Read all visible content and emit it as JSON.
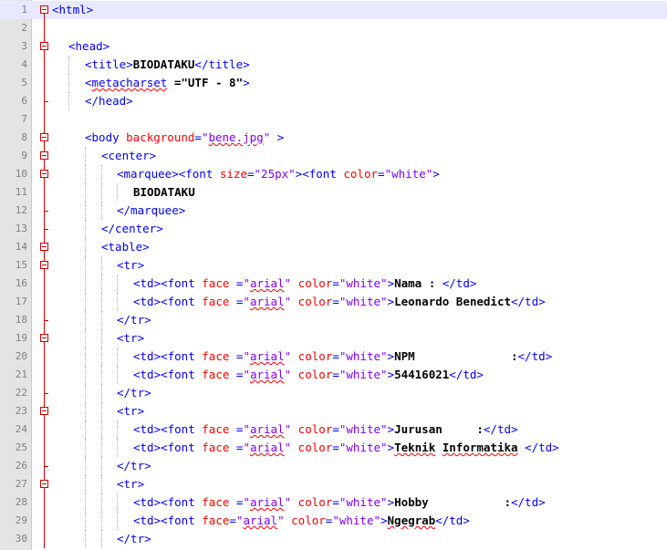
{
  "editor": {
    "lines": [
      {
        "n": "1",
        "tokens": [
          [
            "t",
            "<html>"
          ]
        ]
      },
      {
        "n": "2",
        "tokens": []
      },
      {
        "n": "3",
        "tokens": [
          [
            "t",
            "<head>"
          ]
        ]
      },
      {
        "n": "4",
        "tokens": [
          [
            "t",
            "<title>"
          ],
          [
            "tx",
            "BIODATAKU"
          ],
          [
            "t",
            "</title>"
          ]
        ]
      },
      {
        "n": "5",
        "tokens": [
          [
            "t",
            "<"
          ],
          [
            "sq",
            "metacharset"
          ],
          [
            "tx",
            " =\"UTF - 8\""
          ],
          [
            "t",
            ">"
          ]
        ]
      },
      {
        "n": "6",
        "tokens": [
          [
            "t",
            "</head>"
          ]
        ]
      },
      {
        "n": "7",
        "tokens": []
      },
      {
        "n": "8",
        "tokens": [
          [
            "t",
            "<body "
          ],
          [
            "a",
            "background"
          ],
          [
            "t",
            "="
          ],
          [
            "v",
            "\""
          ],
          [
            "vsq",
            "bene.jpg"
          ],
          [
            "v",
            "\""
          ],
          [
            "t",
            " >"
          ]
        ]
      },
      {
        "n": "9",
        "tokens": [
          [
            "t",
            "<center>"
          ]
        ]
      },
      {
        "n": "10",
        "tokens": [
          [
            "t",
            "<marquee><font "
          ],
          [
            "a",
            "size"
          ],
          [
            "t",
            "="
          ],
          [
            "v",
            "\"25px\""
          ],
          [
            "t",
            "><font "
          ],
          [
            "a",
            "color"
          ],
          [
            "t",
            "="
          ],
          [
            "v",
            "\"white\""
          ],
          [
            "t",
            ">"
          ]
        ]
      },
      {
        "n": "11",
        "tokens": [
          [
            "tx",
            "BIODATAKU"
          ]
        ]
      },
      {
        "n": "12",
        "tokens": [
          [
            "t",
            "</marquee>"
          ]
        ]
      },
      {
        "n": "13",
        "tokens": [
          [
            "t",
            "</center>"
          ]
        ]
      },
      {
        "n": "14",
        "tokens": [
          [
            "t",
            "<table>"
          ]
        ]
      },
      {
        "n": "15",
        "tokens": [
          [
            "t",
            "<tr>"
          ]
        ]
      },
      {
        "n": "16",
        "tokens": [
          [
            "t",
            "<td><font "
          ],
          [
            "a",
            "face"
          ],
          [
            "t",
            " ="
          ],
          [
            "v",
            "\""
          ],
          [
            "vsq",
            "arial"
          ],
          [
            "v",
            "\""
          ],
          [
            "t",
            " "
          ],
          [
            "a",
            "color"
          ],
          [
            "t",
            "="
          ],
          [
            "v",
            "\"white\""
          ],
          [
            "t",
            ">"
          ],
          [
            "tx",
            "Nama : "
          ],
          [
            "t",
            "</td>"
          ]
        ]
      },
      {
        "n": "17",
        "tokens": [
          [
            "t",
            "<td><font "
          ],
          [
            "a",
            "face"
          ],
          [
            "t",
            " ="
          ],
          [
            "v",
            "\""
          ],
          [
            "vsq",
            "arial"
          ],
          [
            "v",
            "\""
          ],
          [
            "t",
            " "
          ],
          [
            "a",
            "color"
          ],
          [
            "t",
            "="
          ],
          [
            "v",
            "\"white\""
          ],
          [
            "t",
            ">"
          ],
          [
            "tx",
            "Leonardo Benedict"
          ],
          [
            "t",
            "</td>"
          ]
        ]
      },
      {
        "n": "18",
        "tokens": [
          [
            "t",
            "</tr>"
          ]
        ]
      },
      {
        "n": "19",
        "tokens": [
          [
            "t",
            "<tr>"
          ]
        ]
      },
      {
        "n": "20",
        "tokens": [
          [
            "t",
            "<td><font "
          ],
          [
            "a",
            "face"
          ],
          [
            "t",
            " ="
          ],
          [
            "v",
            "\""
          ],
          [
            "vsq",
            "arial"
          ],
          [
            "v",
            "\""
          ],
          [
            "t",
            " "
          ],
          [
            "a",
            "color"
          ],
          [
            "t",
            "="
          ],
          [
            "v",
            "\"white\""
          ],
          [
            "t",
            ">"
          ],
          [
            "tx",
            "NPM              :"
          ],
          [
            "t",
            "</td>"
          ]
        ]
      },
      {
        "n": "21",
        "tokens": [
          [
            "t",
            "<td><font "
          ],
          [
            "a",
            "face"
          ],
          [
            "t",
            " ="
          ],
          [
            "v",
            "\""
          ],
          [
            "vsq",
            "arial"
          ],
          [
            "v",
            "\""
          ],
          [
            "t",
            " "
          ],
          [
            "a",
            "color"
          ],
          [
            "t",
            "="
          ],
          [
            "v",
            "\"white\""
          ],
          [
            "t",
            ">"
          ],
          [
            "tx",
            "54416021"
          ],
          [
            "t",
            "</td>"
          ]
        ]
      },
      {
        "n": "22",
        "tokens": [
          [
            "t",
            "</tr>"
          ]
        ]
      },
      {
        "n": "23",
        "tokens": [
          [
            "t",
            "<tr>"
          ]
        ]
      },
      {
        "n": "24",
        "tokens": [
          [
            "t",
            "<td><font "
          ],
          [
            "a",
            "face"
          ],
          [
            "t",
            " ="
          ],
          [
            "v",
            "\""
          ],
          [
            "vsq",
            "arial"
          ],
          [
            "v",
            "\""
          ],
          [
            "t",
            " "
          ],
          [
            "a",
            "color"
          ],
          [
            "t",
            "="
          ],
          [
            "v",
            "\"white\""
          ],
          [
            "t",
            ">"
          ],
          [
            "tx",
            "Jurusan     :"
          ],
          [
            "t",
            "</td>"
          ]
        ]
      },
      {
        "n": "25",
        "tokens": [
          [
            "t",
            "<td><font "
          ],
          [
            "a",
            "face"
          ],
          [
            "t",
            " ="
          ],
          [
            "v",
            "\""
          ],
          [
            "vsq",
            "arial"
          ],
          [
            "v",
            "\""
          ],
          [
            "t",
            " "
          ],
          [
            "a",
            "color"
          ],
          [
            "t",
            "="
          ],
          [
            "v",
            "\"white\""
          ],
          [
            "t",
            ">"
          ],
          [
            "txsq",
            "Teknik"
          ],
          [
            "tx",
            " "
          ],
          [
            "txsq",
            "Informatika"
          ],
          [
            "tx",
            " "
          ],
          [
            "t",
            "</td>"
          ]
        ]
      },
      {
        "n": "26",
        "tokens": [
          [
            "t",
            "</tr>"
          ]
        ]
      },
      {
        "n": "27",
        "tokens": [
          [
            "t",
            "<tr>"
          ]
        ]
      },
      {
        "n": "28",
        "tokens": [
          [
            "t",
            "<td><font "
          ],
          [
            "a",
            "face"
          ],
          [
            "t",
            " ="
          ],
          [
            "v",
            "\""
          ],
          [
            "vsq",
            "arial"
          ],
          [
            "v",
            "\""
          ],
          [
            "t",
            " "
          ],
          [
            "a",
            "color"
          ],
          [
            "t",
            "="
          ],
          [
            "v",
            "\"white\""
          ],
          [
            "t",
            ">"
          ],
          [
            "tx",
            "Hobby           :"
          ],
          [
            "t",
            "</td>"
          ]
        ]
      },
      {
        "n": "29",
        "tokens": [
          [
            "t",
            "<td><font "
          ],
          [
            "a",
            "face"
          ],
          [
            "t",
            "="
          ],
          [
            "v",
            "\""
          ],
          [
            "vsq",
            "arial"
          ],
          [
            "v",
            "\""
          ],
          [
            "t",
            " "
          ],
          [
            "a",
            "color"
          ],
          [
            "t",
            "="
          ],
          [
            "v",
            "\"white\""
          ],
          [
            "t",
            ">"
          ],
          [
            "txsq",
            "Ngegrab"
          ],
          [
            "t",
            "</td>"
          ]
        ]
      },
      {
        "n": "30",
        "tokens": [
          [
            "t",
            "</tr>"
          ]
        ]
      }
    ]
  },
  "colors": {
    "tag": "#0000ff",
    "attribute": "#ff0000",
    "value": "#8000ff",
    "text": "#000000",
    "gutter": "#e4e4e4",
    "fold_marker": "#cc0000",
    "current_line": "#e8e8ff"
  }
}
